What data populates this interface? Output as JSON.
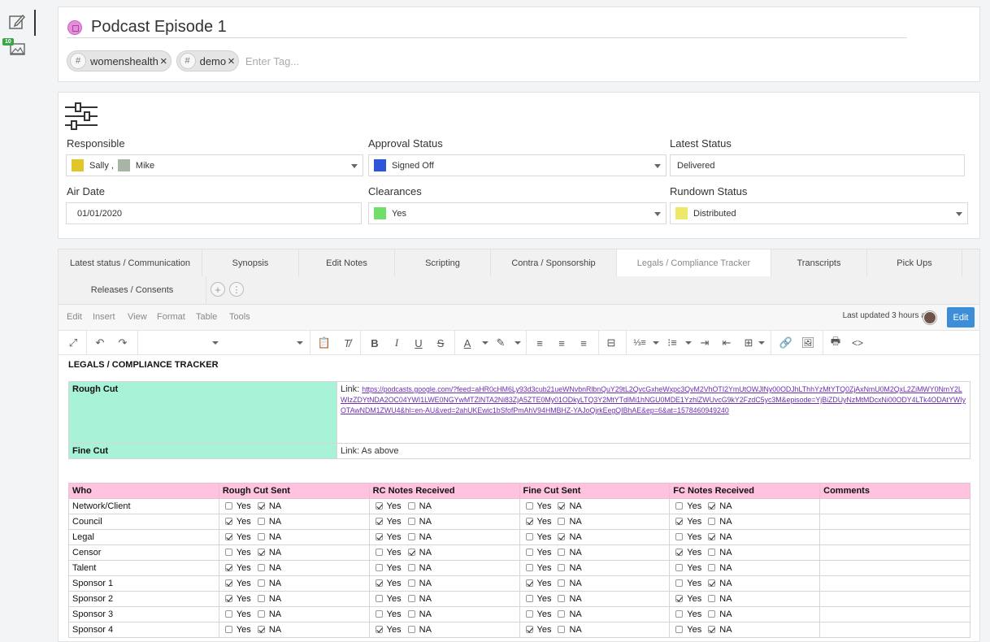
{
  "rail": {
    "badge": "10"
  },
  "header": {
    "title": "Podcast Episode 1",
    "tags": [
      "womenshealth",
      "demo"
    ],
    "tag_placeholder": "Enter Tag..."
  },
  "fields": {
    "responsible_label": "Responsible",
    "responsible_people": [
      {
        "name": "Sally",
        "color": "#e0c629"
      },
      {
        "name": "Mike",
        "color": "#a7b5a4"
      }
    ],
    "responsible_sep": ",",
    "approval_label": "Approval Status",
    "approval_value": "Signed Off",
    "approval_color": "#2c55d9",
    "latest_label": "Latest Status",
    "latest_value": "Delivered",
    "airdate_label": "Air Date",
    "airdate_value": "01/01/2020",
    "clearances_label": "Clearances",
    "clearances_value": "Yes",
    "clearances_color": "#6fde6a",
    "rundown_label": "Rundown Status",
    "rundown_value": "Distributed",
    "rundown_color": "#ede867"
  },
  "tabs": [
    "Latest status / Communication",
    "Synopsis",
    "Edit Notes",
    "Scripting",
    "Contra / Sponsorship",
    "Legals / Compliance Tracker",
    "Transcripts",
    "Pick Ups"
  ],
  "tabs2": [
    "Releases / Consents"
  ],
  "editor": {
    "menu": [
      "Edit",
      "Insert",
      "View",
      "Format",
      "Table",
      "Tools"
    ],
    "last_updated": "Last updated 3 hours ago",
    "edit_label": "Edit"
  },
  "doc": {
    "title": "LEGALS / COMPLIANCE TRACKER",
    "links": [
      {
        "label": "Rough Cut",
        "prefix": "Link: ",
        "url": "https://podcasts.google.com/?feed=aHR0cHM6Ly93d3cub21ueWNvbnRlbnQuY29tL2QvcGxheWxpc3QvM2VhOTI2YmUtOWJlNy00ODJhLThhYzMtYTQ0ZjAxNmU0M2QxL2ZiMWY0NmY2LWIzZDYtNDA2OC04YWI1LWE0NGYwMTZlNTA2Ni83ZjA5ZTE0My01ODkyLTQ3Y2MtYTdlMi1hNGU0MDE1YzhlZWUvcG9kY2FzdC5yc3M&episode=YjBiZDUyNzMtMDcxNi00ODY4LTk4ODAtYWIyOTAwNDM1ZWU4&hl=en-AU&ved=2ahUKEwic1bSfofPmAhV94HMBHZ-YAJoQjrkEegQIBhAE&ep=6&at=1578460949240"
      },
      {
        "label": "Fine Cut",
        "prefix": "Link: As above",
        "url": ""
      }
    ],
    "tracker_headers": [
      "Who",
      "Rough Cut Sent",
      "RC Notes Received",
      "Fine Cut Sent",
      "FC Notes Received",
      "Comments"
    ],
    "yes_label": "Yes",
    "na_label": "NA",
    "tracker_rows": [
      {
        "who": "Network/Client",
        "c": [
          [
            false,
            true
          ],
          [
            true,
            false
          ],
          [
            false,
            true
          ],
          [
            false,
            true
          ]
        ]
      },
      {
        "who": "Council",
        "c": [
          [
            true,
            false
          ],
          [
            true,
            false
          ],
          [
            true,
            false
          ],
          [
            true,
            false
          ]
        ]
      },
      {
        "who": "Legal",
        "c": [
          [
            true,
            false
          ],
          [
            true,
            false
          ],
          [
            false,
            true
          ],
          [
            false,
            true
          ]
        ]
      },
      {
        "who": "Censor",
        "c": [
          [
            false,
            true
          ],
          [
            false,
            true
          ],
          [
            false,
            false
          ],
          [
            true,
            false
          ]
        ]
      },
      {
        "who": "Talent",
        "c": [
          [
            true,
            false
          ],
          [
            false,
            false
          ],
          [
            false,
            false
          ],
          [
            false,
            false
          ]
        ]
      },
      {
        "who": "Sponsor 1",
        "c": [
          [
            true,
            false
          ],
          [
            true,
            false
          ],
          [
            true,
            false
          ],
          [
            false,
            true
          ]
        ]
      },
      {
        "who": "Sponsor 2",
        "c": [
          [
            true,
            false
          ],
          [
            false,
            false
          ],
          [
            false,
            false
          ],
          [
            true,
            false
          ]
        ]
      },
      {
        "who": "Sponsor 3",
        "c": [
          [
            false,
            false
          ],
          [
            false,
            false
          ],
          [
            false,
            false
          ],
          [
            false,
            false
          ]
        ]
      },
      {
        "who": "Sponsor 4",
        "c": [
          [
            false,
            true
          ],
          [
            true,
            false
          ],
          [
            true,
            false
          ],
          [
            false,
            true
          ]
        ]
      }
    ]
  }
}
